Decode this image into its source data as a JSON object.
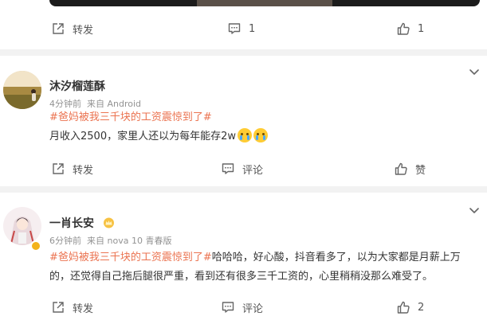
{
  "top_post": {
    "actions": {
      "repost_label": "转发",
      "comment_count": "1",
      "like_count": "1"
    }
  },
  "posts": [
    {
      "username": "沐汐榴莲酥",
      "time": "4分钟前",
      "source": "来自 Android",
      "topic": "#爸妈被我三千块的工资震惊到了#",
      "text": "月收入2500，家里人还以为每年能存2w",
      "emojis": [
        "crying-face-emoji",
        "sobbing-face-emoji"
      ],
      "actions": {
        "repost_label": "转发",
        "comment_label": "评论",
        "like_label": "赞"
      }
    },
    {
      "username": "一肖长安",
      "time": "6分钟前",
      "source": "来自 nova 10 青春版",
      "topic": "#爸妈被我三千块的工资震惊到了#",
      "text": "哈哈哈，好心酸，抖音看多了，以为大家都是月薪上万的，还觉得自己拖后腿很严重，看到还有很多三千工资的，心里稍稍没那么难受了。",
      "actions": {
        "repost_label": "转发",
        "comment_label": "评论",
        "like_count": "2"
      }
    }
  ],
  "colors": {
    "topic": "#eb7350",
    "meta": "#939393",
    "separator": "#f2f2f2",
    "badge": "#f3b21b"
  }
}
